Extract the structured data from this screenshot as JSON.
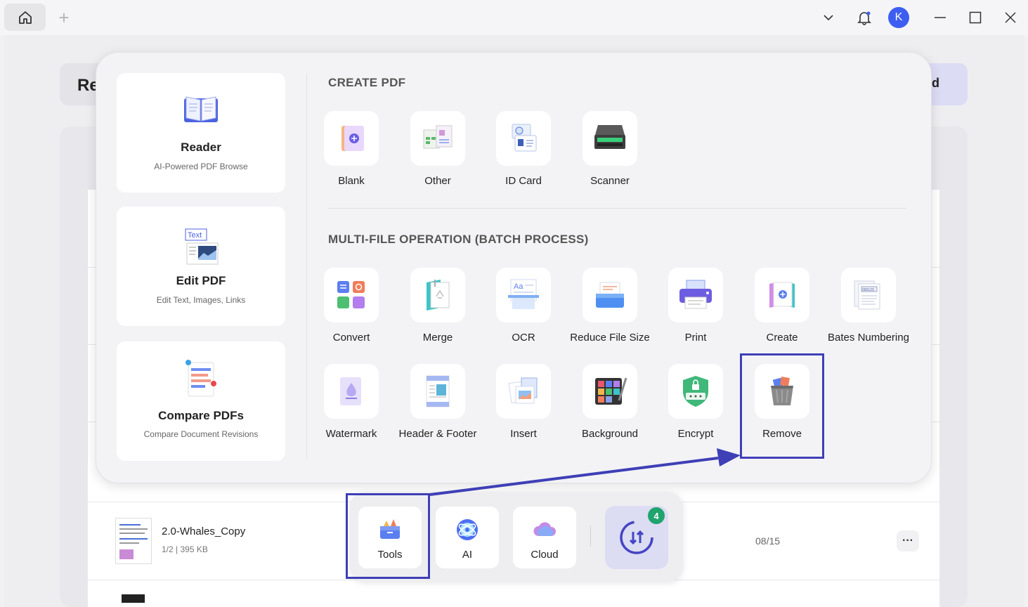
{
  "window": {
    "avatar_initial": "K",
    "icons": [
      "home-icon",
      "plus-icon",
      "chevron-down-icon",
      "bell-icon",
      "minimize-icon",
      "maximize-icon",
      "close-icon"
    ]
  },
  "background": {
    "left_card_text": "Re",
    "right_card_text": "d",
    "file": {
      "name": "2.0-Whales_Copy",
      "meta": "1/2 | 395 KB",
      "pages": "08/15",
      "more": "···"
    }
  },
  "sidebar": [
    {
      "title": "Reader",
      "subtitle": "AI-Powered PDF Browse",
      "icon": "reader-book-icon"
    },
    {
      "title": "Edit PDF",
      "subtitle": "Edit Text, Images, Links",
      "icon": "edit-text-icon"
    },
    {
      "title": "Compare PDFs",
      "subtitle": "Compare Document Revisions",
      "icon": "compare-icon"
    }
  ],
  "create_pdf": {
    "title": "CREATE PDF",
    "tools": [
      {
        "label": "Blank",
        "icon": "blank-icon"
      },
      {
        "label": "Other",
        "icon": "other-icon"
      },
      {
        "label": "ID Card",
        "icon": "id-card-icon"
      },
      {
        "label": "Scanner",
        "icon": "scanner-icon"
      }
    ]
  },
  "batch": {
    "title": "MULTI-FILE OPERATION (BATCH PROCESS)",
    "row1": [
      {
        "label": "Convert",
        "icon": "convert-icon"
      },
      {
        "label": "Merge",
        "icon": "merge-icon"
      },
      {
        "label": "OCR",
        "icon": "ocr-icon"
      },
      {
        "label": "Reduce File Size",
        "icon": "reduce-file-size-icon"
      },
      {
        "label": "Print",
        "icon": "print-icon"
      },
      {
        "label": "Create",
        "icon": "create-icon"
      },
      {
        "label": "Bates Numbering",
        "icon": "bates-numbering-icon"
      }
    ],
    "row2": [
      {
        "label": "Watermark",
        "icon": "watermark-icon"
      },
      {
        "label": "Header & Footer",
        "icon": "header-footer-icon"
      },
      {
        "label": "Insert",
        "icon": "insert-icon"
      },
      {
        "label": "Background",
        "icon": "background-icon"
      },
      {
        "label": "Encrypt",
        "icon": "encrypt-icon"
      },
      {
        "label": "Remove",
        "icon": "remove-trash-icon"
      }
    ]
  },
  "dock": {
    "tools": "Tools",
    "ai": "AI",
    "cloud": "Cloud",
    "badge_count": "4"
  },
  "colors": {
    "accent": "#3f3fb6",
    "avatar": "#3d5ef0",
    "badge": "#21a36d"
  }
}
